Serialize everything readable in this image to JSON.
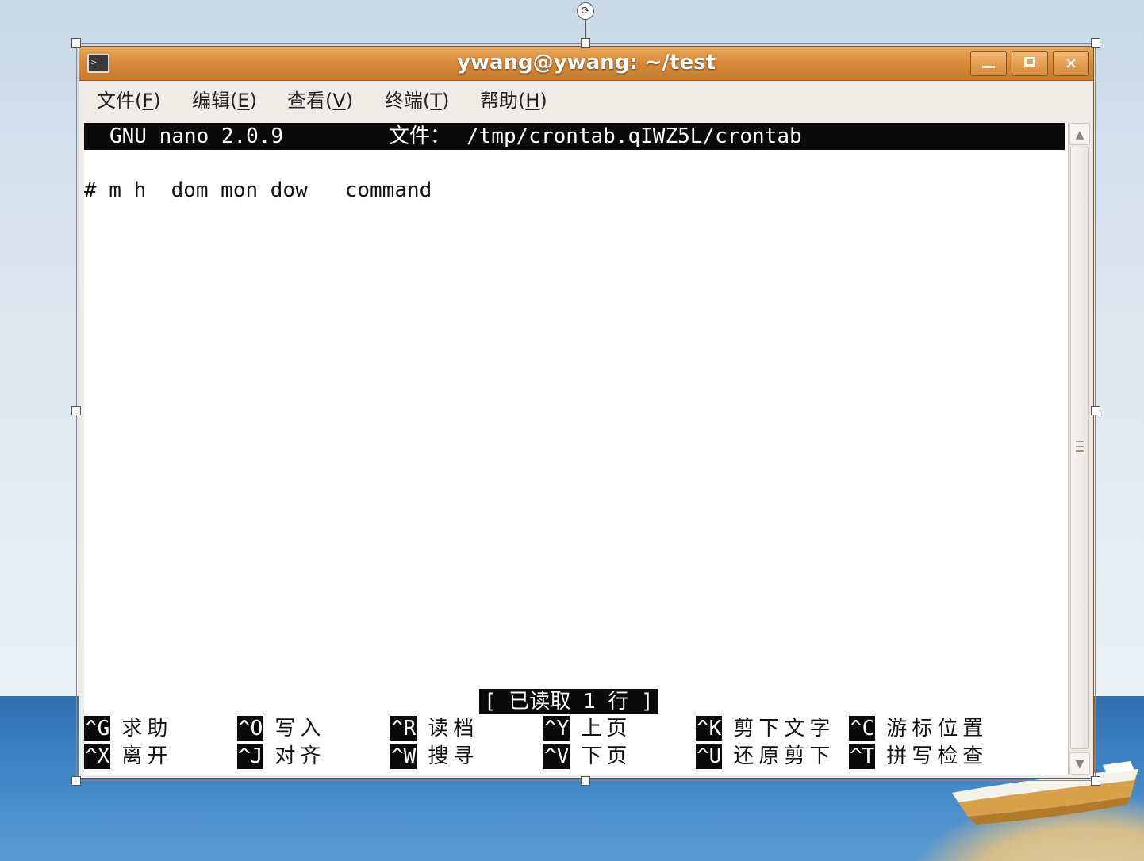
{
  "window": {
    "title": "ywang@ywang: ~/test",
    "minimize_icon": "minimize-icon",
    "maximize_icon": "maximize-icon",
    "close_icon": "close-icon",
    "close_glyph": "✕"
  },
  "menubar": {
    "items": [
      {
        "label": "文件(",
        "mnemonic": "F",
        "suffix": ")"
      },
      {
        "label": "编辑(",
        "mnemonic": "E",
        "suffix": ")"
      },
      {
        "label": "查看(",
        "mnemonic": "V",
        "suffix": ")"
      },
      {
        "label": "终端(",
        "mnemonic": "T",
        "suffix": ")"
      },
      {
        "label": "帮助(",
        "mnemonic": "H",
        "suffix": ")"
      }
    ]
  },
  "nano": {
    "version": "GNU nano 2.0.9",
    "file_label": "文件：",
    "file_path": "/tmp/crontab.qIWZ5L/crontab",
    "content_lines": [
      "# m h  dom mon dow   command"
    ],
    "status_message": "[ 已读取 1 行 ]",
    "shortcuts_row1": [
      {
        "key": "^G",
        "desc": "求助"
      },
      {
        "key": "^O",
        "desc": "写入"
      },
      {
        "key": "^R",
        "desc": "读档"
      },
      {
        "key": "^Y",
        "desc": "上页"
      },
      {
        "key": "^K",
        "desc": "剪下文字"
      },
      {
        "key": "^C",
        "desc": "游标位置"
      }
    ],
    "shortcuts_row2": [
      {
        "key": "^X",
        "desc": "离开"
      },
      {
        "key": "^J",
        "desc": "对齐"
      },
      {
        "key": "^W",
        "desc": "搜寻"
      },
      {
        "key": "^V",
        "desc": "下页"
      },
      {
        "key": "^U",
        "desc": "还原剪下"
      },
      {
        "key": "^T",
        "desc": "拼写检查"
      }
    ]
  },
  "colors": {
    "titlebar": "#d68a38",
    "terminal_bg": "#ffffff",
    "nano_bar": "#0a0a0a"
  }
}
